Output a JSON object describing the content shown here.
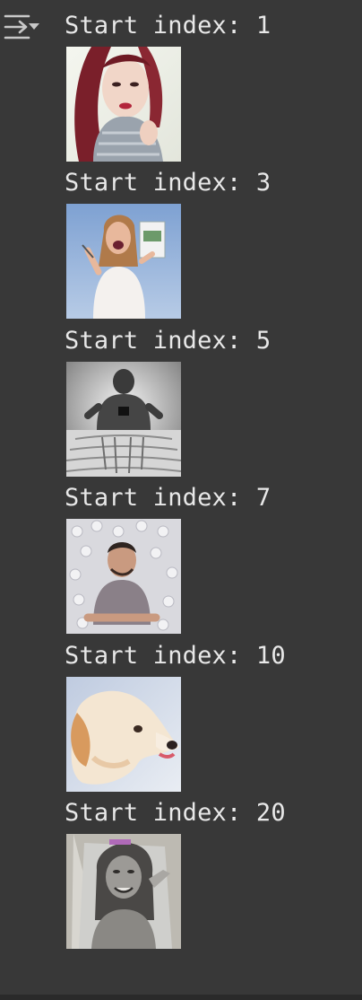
{
  "toolbar": {
    "icon": "output-collapse-icon"
  },
  "entries": [
    {
      "label": "Start index: 1",
      "image": "woman-with-red-hair-scarf-thumbnail"
    },
    {
      "label": "Start index: 3",
      "image": "woman-holding-brochure-thumbnail"
    },
    {
      "label": "Start index: 5",
      "image": "man-in-water-thumbnail"
    },
    {
      "label": "Start index: 7",
      "image": "man-lying-among-flowers-thumbnail"
    },
    {
      "label": "Start index: 10",
      "image": "dog-portrait-thumbnail"
    },
    {
      "label": "Start index: 20",
      "image": "woman-sketch-portrait-thumbnail"
    }
  ],
  "colors": {
    "background": "#383838",
    "text": "#e8e8e8",
    "icon": "#c8c8c8"
  }
}
